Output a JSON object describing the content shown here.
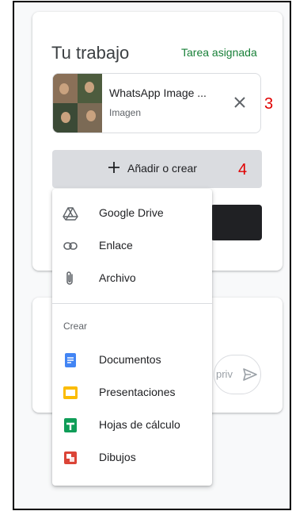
{
  "your_work": {
    "title": "Tu trabajo",
    "status": "Tarea asignada"
  },
  "attachment": {
    "title": "WhatsApp Image ...",
    "type": "Imagen",
    "remove_icon": "close-icon"
  },
  "annotations": {
    "remove_marker": "3",
    "add_marker": "4"
  },
  "add_button": {
    "label": "Añadir o crear",
    "icon": "plus-icon"
  },
  "comment": {
    "placeholder_fragment": "priv",
    "send_icon": "send-icon"
  },
  "menu": {
    "items": [
      {
        "label": "Google Drive",
        "icon": "google-drive-icon"
      },
      {
        "label": "Enlace",
        "icon": "link-icon"
      },
      {
        "label": "Archivo",
        "icon": "paperclip-icon"
      }
    ],
    "create_header": "Crear",
    "create_items": [
      {
        "label": "Documentos",
        "icon": "google-docs-icon",
        "color": "#4285f4"
      },
      {
        "label": "Presentaciones",
        "icon": "google-slides-icon",
        "color": "#fbbc04"
      },
      {
        "label": "Hojas de cálculo",
        "icon": "google-sheets-icon",
        "color": "#0f9d58"
      },
      {
        "label": "Dibujos",
        "icon": "google-drawings-icon",
        "color": "#db4437"
      }
    ]
  },
  "colors": {
    "status_green": "#188038",
    "annotation_red": "#e00000",
    "button_gray": "#dadce0"
  }
}
